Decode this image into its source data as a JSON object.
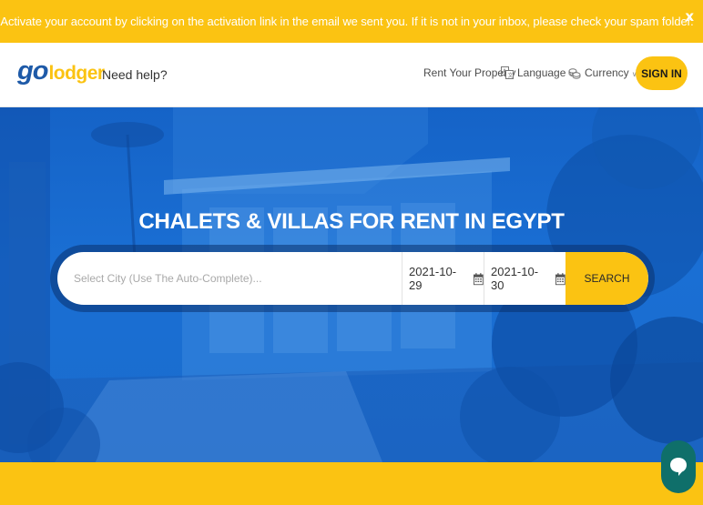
{
  "notice": {
    "text": "Activate your account by clicking on the activation link in the email we sent you. If it is not in your inbox, please check your spam folder.",
    "close": "x"
  },
  "header": {
    "logo_go": "go",
    "logo_lodger": "lodger",
    "need_help": "Need help?",
    "rent_property": "Rent Your Property",
    "language": "Language",
    "currency": "Currency",
    "sign_in": "SIGN IN"
  },
  "hero": {
    "title": "CHALETS & VILLAS FOR RENT IN EGYPT"
  },
  "search": {
    "city_placeholder": "Select City (Use The Auto-Complete)...",
    "checkin": "2021-10-29",
    "checkout": "2021-10-30",
    "button": "SEARCH"
  },
  "colors": {
    "accent": "#fbc312",
    "brand_blue": "#1e5aa8",
    "hero_blue": "#1a6fd4",
    "chat": "#0f6f6a"
  },
  "icons": {
    "language": "translate-icon",
    "currency": "coins-icon",
    "calendar": "calendar-icon",
    "chat": "chat-bubble-icon"
  }
}
